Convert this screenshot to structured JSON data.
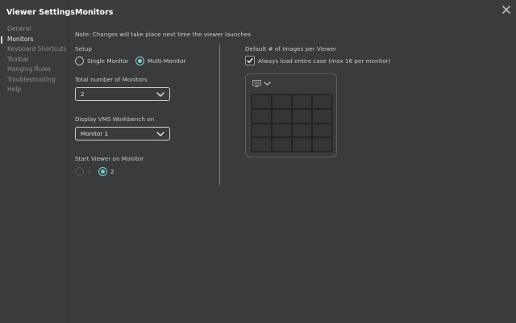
{
  "sidebar": {
    "title": "Viewer Settings",
    "items": [
      {
        "label": "General",
        "active": false
      },
      {
        "label": "Monitors",
        "active": true
      },
      {
        "label": "Keyboard Shortcuts",
        "active": false
      },
      {
        "label": "Toolbar",
        "active": false
      },
      {
        "label": "Hanging Rules",
        "active": false
      },
      {
        "label": "Troubleshooting",
        "active": false
      },
      {
        "label": "Help",
        "active": false
      }
    ]
  },
  "header": {
    "title": "Monitors",
    "close_icon": "close-icon"
  },
  "note": "Note: Changes will take place next time the viewer launches",
  "setup": {
    "label": "Setup",
    "options": [
      {
        "label": "Single Monitor",
        "checked": false
      },
      {
        "label": "Multi-Monitor",
        "checked": true
      }
    ]
  },
  "total_monitors": {
    "label": "Total number of Monitors",
    "value": "2"
  },
  "workbench": {
    "label": "Display VMS Workbench on",
    "value": "Monitor 1"
  },
  "start_viewer": {
    "label": "Start Viewer on Monitor",
    "options": [
      {
        "label": "1",
        "checked": false,
        "disabled": true
      },
      {
        "label": "2",
        "checked": true,
        "disabled": false
      }
    ]
  },
  "images_per_viewer": {
    "label": "Default # of Images per Viewer",
    "always_load_label": "Always load entire case (max 16 per monitor)",
    "always_load_checked": true,
    "monitor_icon": "monitor-icon",
    "grid_rows": 4,
    "grid_cols": 4
  },
  "colors": {
    "background": "#3a3b3d",
    "accent": "#7fd0d6",
    "text": "#d6d6d6"
  }
}
